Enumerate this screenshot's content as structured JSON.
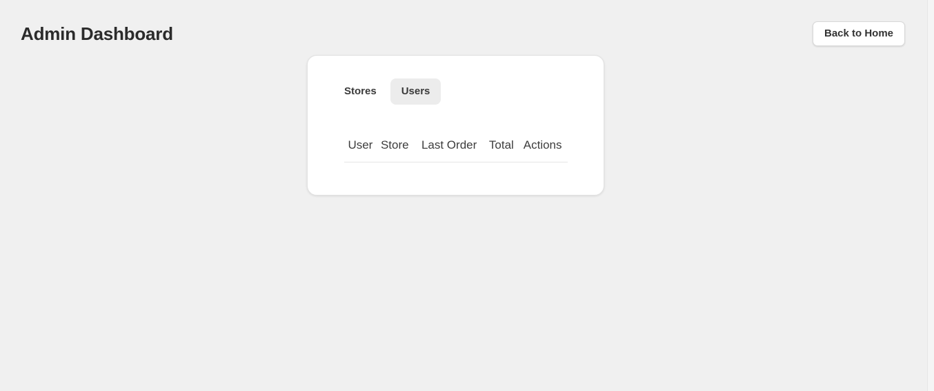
{
  "header": {
    "title": "Admin Dashboard",
    "back_button_label": "Back to Home"
  },
  "tabs": [
    {
      "label": "Stores",
      "active": false
    },
    {
      "label": "Users",
      "active": true
    }
  ],
  "table": {
    "columns": [
      "User",
      "Store",
      "Last Order",
      "Total",
      "Actions"
    ],
    "rows": []
  }
}
